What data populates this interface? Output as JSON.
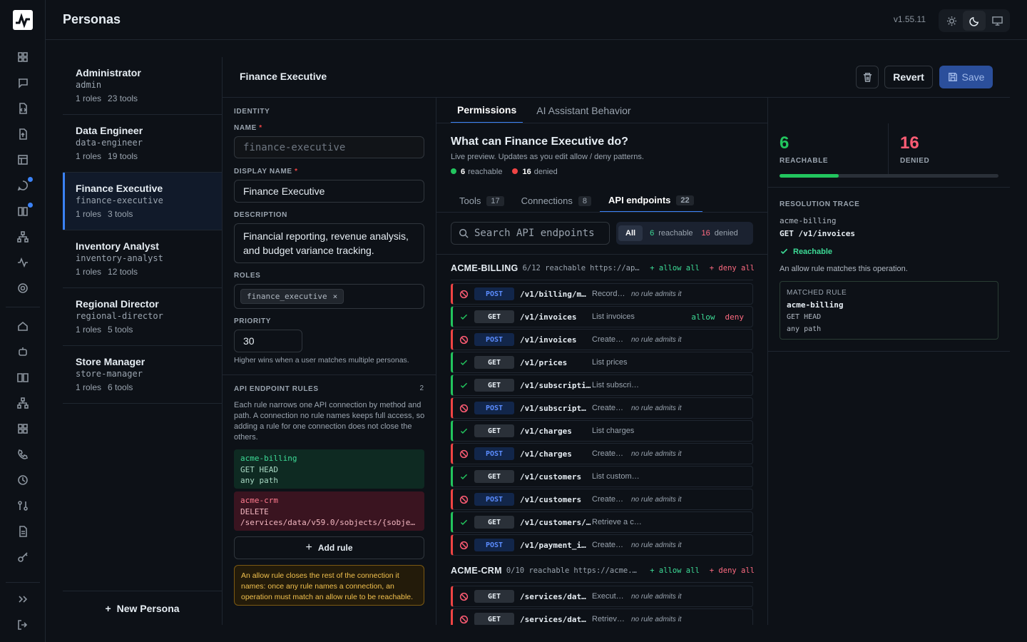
{
  "app": {
    "title": "Personas",
    "version": "v1.55.11"
  },
  "personas": [
    {
      "name": "Administrator",
      "slug": "admin",
      "roles": "1 roles",
      "tools": "23 tools"
    },
    {
      "name": "Data Engineer",
      "slug": "data-engineer",
      "roles": "1 roles",
      "tools": "19 tools"
    },
    {
      "name": "Finance Executive",
      "slug": "finance-executive",
      "roles": "1 roles",
      "tools": "3 tools"
    },
    {
      "name": "Inventory Analyst",
      "slug": "inventory-analyst",
      "roles": "1 roles",
      "tools": "12 tools"
    },
    {
      "name": "Regional Director",
      "slug": "regional-director",
      "roles": "1 roles",
      "tools": "5 tools"
    },
    {
      "name": "Store Manager",
      "slug": "store-manager",
      "roles": "1 roles",
      "tools": "6 tools"
    }
  ],
  "new_persona": "New Persona",
  "header": {
    "title": "Finance Executive",
    "revert": "Revert",
    "save": "Save"
  },
  "form": {
    "identity": "IDENTITY",
    "name_label": "NAME",
    "name_value": "finance-executive",
    "display_label": "DISPLAY NAME",
    "display_value": "Finance Executive",
    "desc_label": "DESCRIPTION",
    "desc_value": "Financial reporting, revenue analysis, and budget variance tracking.",
    "roles_label": "ROLES",
    "role_chip": "finance_executive",
    "priority_label": "PRIORITY",
    "priority_value": "30",
    "priority_help": "Higher wins when a user matches multiple personas.",
    "rules_label": "API ENDPOINT RULES",
    "rules_count": "2",
    "rules_help": "Each rule narrows one API connection by method and path. A connection no rule names keeps full access, so adding a rule for one connection does not close the others.",
    "rules": [
      {
        "conn": "acme-billing",
        "methods": "GET HEAD",
        "path": "any path",
        "kind": "allow"
      },
      {
        "conn": "acme-crm",
        "methods": "DELETE",
        "path": "/services/data/v59.0/sobjects/{sobje…",
        "kind": "deny"
      }
    ],
    "add_rule": "Add rule",
    "warning": "An allow rule closes the rest of the connection it names: once any rule names a connection, an operation must match an allow rule to be reachable."
  },
  "tabs": [
    "Permissions",
    "AI Assistant Behavior"
  ],
  "preview": {
    "question": "What can Finance Executive do?",
    "sub": "Live preview. Updates as you edit allow / deny patterns.",
    "reachable_n": "6",
    "reachable_t": "reachable",
    "denied_n": "16",
    "denied_t": "denied",
    "subtabs": [
      {
        "label": "Tools",
        "count": "17"
      },
      {
        "label": "Connections",
        "count": "8"
      },
      {
        "label": "API endpoints",
        "count": "22"
      }
    ],
    "search_placeholder": "Search API endpoints",
    "filter": {
      "all": "All",
      "g_n": "6",
      "g_t": "reachable",
      "r_n": "16",
      "r_t": "denied"
    }
  },
  "groups": [
    {
      "name": "ACME-BILLING",
      "meta": "6/12 reachable",
      "url": "https://ap…",
      "allow_all": "+ allow all",
      "deny_all": "+ deny all",
      "endpoints": [
        {
          "ok": false,
          "method": "POST",
          "path": "/v1/billing/m…",
          "desc": "Record…",
          "note": "no rule admits it"
        },
        {
          "ok": true,
          "method": "GET",
          "path": "/v1/invoices",
          "desc": "List invoices",
          "allow": "allow",
          "deny": "deny"
        },
        {
          "ok": false,
          "method": "POST",
          "path": "/v1/invoices",
          "desc": "Create…",
          "note": "no rule admits it"
        },
        {
          "ok": true,
          "method": "GET",
          "path": "/v1/prices",
          "desc": "List prices"
        },
        {
          "ok": true,
          "method": "GET",
          "path": "/v1/subscriptions",
          "desc": "List subscri…"
        },
        {
          "ok": false,
          "method": "POST",
          "path": "/v1/subscript…",
          "desc": "Create…",
          "note": "no rule admits it"
        },
        {
          "ok": true,
          "method": "GET",
          "path": "/v1/charges",
          "desc": "List charges"
        },
        {
          "ok": false,
          "method": "POST",
          "path": "/v1/charges",
          "desc": "Create…",
          "note": "no rule admits it"
        },
        {
          "ok": true,
          "method": "GET",
          "path": "/v1/customers",
          "desc": "List custom…"
        },
        {
          "ok": false,
          "method": "POST",
          "path": "/v1/customers",
          "desc": "Create…",
          "note": "no rule admits it"
        },
        {
          "ok": true,
          "method": "GET",
          "path": "/v1/customers/{custom…",
          "desc": "Retrieve a c…"
        },
        {
          "ok": false,
          "method": "POST",
          "path": "/v1/payment_i…",
          "desc": "Create…",
          "note": "no rule admits it"
        }
      ]
    },
    {
      "name": "ACME-CRM",
      "meta": "0/10 reachable",
      "url": "https://acme.…",
      "allow_all": "+ allow all",
      "deny_all": "+ deny all",
      "endpoints": [
        {
          "ok": false,
          "method": "GET",
          "path": "/services/dat…",
          "desc": "Execut…",
          "note": "no rule admits it"
        },
        {
          "ok": false,
          "method": "GET",
          "path": "/services/dat…",
          "desc": "Retriev…",
          "note": "no rule admits it"
        }
      ]
    }
  ],
  "stats": {
    "reachable": "6",
    "reachable_label": "REACHABLE",
    "denied": "16",
    "denied_label": "DENIED",
    "reachable_fraction": 0.27
  },
  "trace": {
    "title": "RESOLUTION TRACE",
    "conn": "acme-billing",
    "op": "GET /v1/invoices",
    "result": "Reachable",
    "explain": "An allow rule matches this operation.",
    "matched_label": "MATCHED RULE",
    "matched_conn": "acme-billing",
    "matched_methods": "GET HEAD",
    "matched_path": "any path"
  },
  "colors": {
    "accent": "#3b82f6",
    "allow": "#22c55e",
    "deny": "#ef4444"
  }
}
